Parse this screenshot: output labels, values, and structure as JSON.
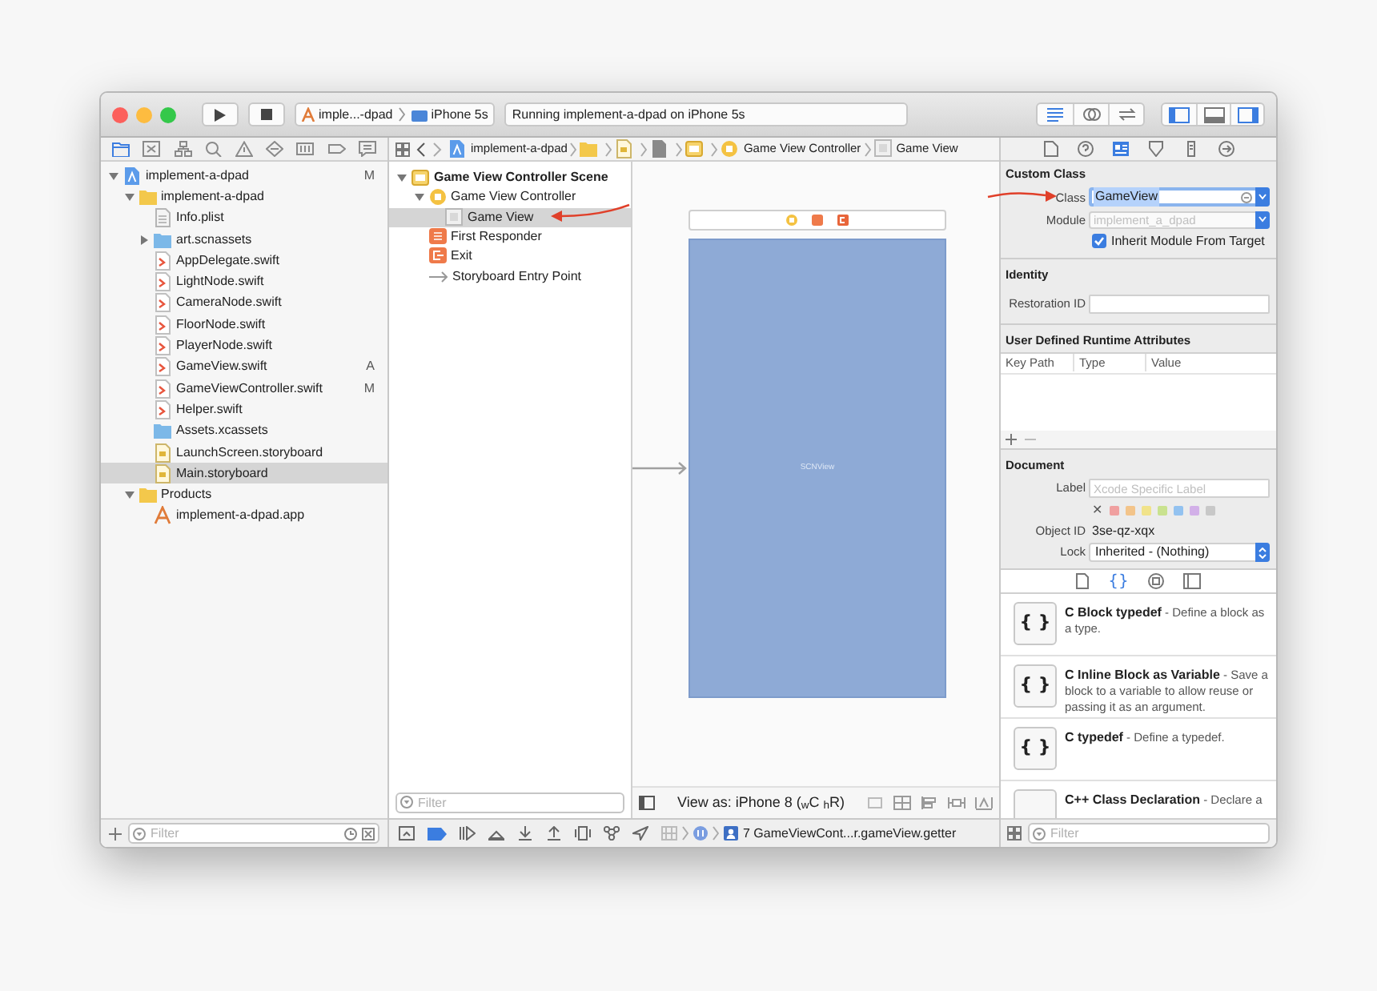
{
  "toolbar": {
    "scheme": "imple...-dpad",
    "device": "iPhone 5s",
    "status": "Running implement-a-dpad on iPhone 5s",
    "editor_modes": [
      {
        "selected": true
      },
      {
        "selected": false
      },
      {
        "selected": false
      }
    ],
    "panels": [
      {
        "on": true
      },
      {
        "on": false
      },
      {
        "on": true
      }
    ]
  },
  "navigator": {
    "tabs": [
      {
        "selected": true
      },
      {
        "selected": false
      },
      {
        "selected": false
      },
      {
        "selected": false
      },
      {
        "selected": false
      },
      {
        "selected": false
      },
      {
        "selected": false
      },
      {
        "selected": false
      },
      {
        "selected": false
      }
    ],
    "tree": [
      {
        "kind": "project",
        "name": "implement-a-dpad",
        "badge": "M",
        "selected": false,
        "expanded": true,
        "children": [
          {
            "kind": "folder",
            "name": "implement-a-dpad",
            "selected": false,
            "expanded": true,
            "children": [
              {
                "kind": "plist",
                "name": "Info.plist",
                "selected": false
              },
              {
                "kind": "assets",
                "name": "art.scnassets",
                "selected": false,
                "expanded": false
              },
              {
                "kind": "swift",
                "name": "AppDelegate.swift",
                "selected": false
              },
              {
                "kind": "swift",
                "name": "LightNode.swift",
                "selected": false
              },
              {
                "kind": "swift",
                "name": "CameraNode.swift",
                "selected": false
              },
              {
                "kind": "swift",
                "name": "FloorNode.swift",
                "selected": false
              },
              {
                "kind": "swift",
                "name": "PlayerNode.swift",
                "selected": false
              },
              {
                "kind": "swift",
                "name": "GameView.swift",
                "badge": "A",
                "selected": false
              },
              {
                "kind": "swift",
                "name": "GameViewController.swift",
                "badge": "M",
                "selected": false
              },
              {
                "kind": "swift",
                "name": "Helper.swift",
                "selected": false
              },
              {
                "kind": "assets",
                "name": "Assets.xcassets",
                "selected": false
              },
              {
                "kind": "storyboard",
                "name": "LaunchScreen.storyboard",
                "selected": false
              },
              {
                "kind": "storyboard",
                "name": "Main.storyboard",
                "selected": true
              }
            ]
          },
          {
            "kind": "folder",
            "name": "Products",
            "selected": false,
            "expanded": true,
            "children": [
              {
                "kind": "app",
                "name": "implement-a-dpad.app",
                "selected": false
              }
            ]
          }
        ]
      }
    ],
    "filter": {
      "placeholder": "Filter"
    }
  },
  "jump_bar": [
    {
      "kind": "project",
      "label": "implement-a-dpad"
    },
    {
      "kind": "folder"
    },
    {
      "kind": "storyboard"
    },
    {
      "kind": "document"
    },
    {
      "kind": "scene"
    },
    {
      "kind": "controller",
      "label": "Game View Controller"
    },
    {
      "kind": "view",
      "label": "Game View"
    }
  ],
  "outline": {
    "tree": [
      {
        "kind": "scene",
        "name": "Game View Controller Scene",
        "selected": false,
        "expanded": true,
        "children": [
          {
            "kind": "controller",
            "name": "Game View Controller",
            "selected": false,
            "expanded": true,
            "children": [
              {
                "kind": "view",
                "name": "Game View",
                "selected": true
              }
            ]
          },
          {
            "kind": "responder",
            "name": "First Responder",
            "selected": false
          },
          {
            "kind": "exit",
            "name": "Exit",
            "selected": false
          },
          {
            "kind": "entry",
            "name": "Storyboard Entry Point",
            "selected": false
          }
        ]
      }
    ],
    "filter": {
      "placeholder": "Filter"
    }
  },
  "canvas": {
    "view_label": "SCNView",
    "view_as": "View as: iPhone 8 ($_{w}$C $_{h}$R)"
  },
  "debug_bar": {
    "breakpoints_active": true,
    "frame": "7 GameViewCont...r.gameView.getter"
  },
  "inspector": {
    "tabs": [
      {
        "selected": false
      },
      {
        "selected": false
      },
      {
        "selected": true
      },
      {
        "selected": false
      },
      {
        "selected": false
      },
      {
        "selected": false
      }
    ],
    "custom_class": {
      "title": "Custom Class",
      "class_label": "Class",
      "class_value": "GameView",
      "module_label": "Module",
      "module_placeholder": "implement_a_dpad",
      "inherit_label": "Inherit Module From Target",
      "inherit_checked": true
    },
    "identity": {
      "title": "Identity",
      "restoration_label": "Restoration ID"
    },
    "runtime_attributes": {
      "title": "User Defined Runtime Attributes",
      "columns": [
        "Key Path",
        "Type",
        "Value"
      ]
    },
    "document": {
      "title": "Document",
      "label_label": "Label",
      "label_placeholder": "Xcode Specific Label",
      "clear": "✕",
      "colors": [
        {
          "color": "#f0a0a0"
        },
        {
          "color": "#f3c48a"
        },
        {
          "color": "#f1e38a"
        },
        {
          "color": "#c9e28f"
        },
        {
          "color": "#93c2f0"
        },
        {
          "color": "#d2b0e8"
        },
        {
          "color": "#c8c8c8"
        }
      ],
      "object_id_label": "Object ID",
      "object_id": "3se-qz-xqx",
      "lock_label": "Lock",
      "lock_value": "Inherited - (Nothing)"
    }
  },
  "library": {
    "tabs": [
      {
        "kind": "file",
        "selected": false
      },
      {
        "kind": "snippet",
        "glyph": "{}",
        "selected": true
      },
      {
        "kind": "object",
        "selected": false
      },
      {
        "kind": "media",
        "selected": false
      }
    ],
    "items": [
      {
        "glyph": "{ }",
        "title": "C Block typedef",
        "description": " - Define a block as a type."
      },
      {
        "glyph": "{ }",
        "title": "C Inline Block as Variable",
        "description": " - Save a block to a variable to allow reuse or passing it as an argument."
      },
      {
        "glyph": "{ }",
        "title": "C typedef",
        "description": " - Define a typedef."
      },
      {
        "title": "C++ Class Declaration",
        "description": " - Declare a"
      }
    ],
    "filter": {
      "placeholder": "Filter"
    }
  }
}
